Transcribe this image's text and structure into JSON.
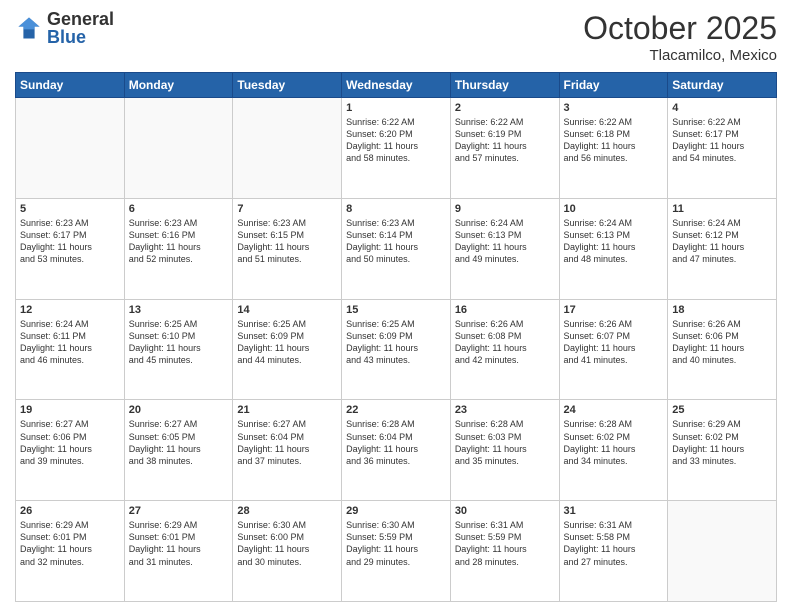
{
  "header": {
    "logo_general": "General",
    "logo_blue": "Blue",
    "month": "October 2025",
    "location": "Tlacamilco, Mexico"
  },
  "weekdays": [
    "Sunday",
    "Monday",
    "Tuesday",
    "Wednesday",
    "Thursday",
    "Friday",
    "Saturday"
  ],
  "weeks": [
    [
      {
        "day": "",
        "empty": true
      },
      {
        "day": "",
        "empty": true
      },
      {
        "day": "",
        "empty": true
      },
      {
        "day": "1",
        "sunrise": "6:22 AM",
        "sunset": "6:20 PM",
        "daylight": "11 hours and 58 minutes."
      },
      {
        "day": "2",
        "sunrise": "6:22 AM",
        "sunset": "6:19 PM",
        "daylight": "11 hours and 57 minutes."
      },
      {
        "day": "3",
        "sunrise": "6:22 AM",
        "sunset": "6:18 PM",
        "daylight": "11 hours and 56 minutes."
      },
      {
        "day": "4",
        "sunrise": "6:22 AM",
        "sunset": "6:17 PM",
        "daylight": "11 hours and 54 minutes."
      }
    ],
    [
      {
        "day": "5",
        "sunrise": "6:23 AM",
        "sunset": "6:17 PM",
        "daylight": "11 hours and 53 minutes."
      },
      {
        "day": "6",
        "sunrise": "6:23 AM",
        "sunset": "6:16 PM",
        "daylight": "11 hours and 52 minutes."
      },
      {
        "day": "7",
        "sunrise": "6:23 AM",
        "sunset": "6:15 PM",
        "daylight": "11 hours and 51 minutes."
      },
      {
        "day": "8",
        "sunrise": "6:23 AM",
        "sunset": "6:14 PM",
        "daylight": "11 hours and 50 minutes."
      },
      {
        "day": "9",
        "sunrise": "6:24 AM",
        "sunset": "6:13 PM",
        "daylight": "11 hours and 49 minutes."
      },
      {
        "day": "10",
        "sunrise": "6:24 AM",
        "sunset": "6:13 PM",
        "daylight": "11 hours and 48 minutes."
      },
      {
        "day": "11",
        "sunrise": "6:24 AM",
        "sunset": "6:12 PM",
        "daylight": "11 hours and 47 minutes."
      }
    ],
    [
      {
        "day": "12",
        "sunrise": "6:24 AM",
        "sunset": "6:11 PM",
        "daylight": "11 hours and 46 minutes."
      },
      {
        "day": "13",
        "sunrise": "6:25 AM",
        "sunset": "6:10 PM",
        "daylight": "11 hours and 45 minutes."
      },
      {
        "day": "14",
        "sunrise": "6:25 AM",
        "sunset": "6:09 PM",
        "daylight": "11 hours and 44 minutes."
      },
      {
        "day": "15",
        "sunrise": "6:25 AM",
        "sunset": "6:09 PM",
        "daylight": "11 hours and 43 minutes."
      },
      {
        "day": "16",
        "sunrise": "6:26 AM",
        "sunset": "6:08 PM",
        "daylight": "11 hours and 42 minutes."
      },
      {
        "day": "17",
        "sunrise": "6:26 AM",
        "sunset": "6:07 PM",
        "daylight": "11 hours and 41 minutes."
      },
      {
        "day": "18",
        "sunrise": "6:26 AM",
        "sunset": "6:06 PM",
        "daylight": "11 hours and 40 minutes."
      }
    ],
    [
      {
        "day": "19",
        "sunrise": "6:27 AM",
        "sunset": "6:06 PM",
        "daylight": "11 hours and 39 minutes."
      },
      {
        "day": "20",
        "sunrise": "6:27 AM",
        "sunset": "6:05 PM",
        "daylight": "11 hours and 38 minutes."
      },
      {
        "day": "21",
        "sunrise": "6:27 AM",
        "sunset": "6:04 PM",
        "daylight": "11 hours and 37 minutes."
      },
      {
        "day": "22",
        "sunrise": "6:28 AM",
        "sunset": "6:04 PM",
        "daylight": "11 hours and 36 minutes."
      },
      {
        "day": "23",
        "sunrise": "6:28 AM",
        "sunset": "6:03 PM",
        "daylight": "11 hours and 35 minutes."
      },
      {
        "day": "24",
        "sunrise": "6:28 AM",
        "sunset": "6:02 PM",
        "daylight": "11 hours and 34 minutes."
      },
      {
        "day": "25",
        "sunrise": "6:29 AM",
        "sunset": "6:02 PM",
        "daylight": "11 hours and 33 minutes."
      }
    ],
    [
      {
        "day": "26",
        "sunrise": "6:29 AM",
        "sunset": "6:01 PM",
        "daylight": "11 hours and 32 minutes."
      },
      {
        "day": "27",
        "sunrise": "6:29 AM",
        "sunset": "6:01 PM",
        "daylight": "11 hours and 31 minutes."
      },
      {
        "day": "28",
        "sunrise": "6:30 AM",
        "sunset": "6:00 PM",
        "daylight": "11 hours and 30 minutes."
      },
      {
        "day": "29",
        "sunrise": "6:30 AM",
        "sunset": "5:59 PM",
        "daylight": "11 hours and 29 minutes."
      },
      {
        "day": "30",
        "sunrise": "6:31 AM",
        "sunset": "5:59 PM",
        "daylight": "11 hours and 28 minutes."
      },
      {
        "day": "31",
        "sunrise": "6:31 AM",
        "sunset": "5:58 PM",
        "daylight": "11 hours and 27 minutes."
      },
      {
        "day": "",
        "empty": true
      }
    ]
  ],
  "labels": {
    "sunrise": "Sunrise:",
    "sunset": "Sunset:",
    "daylight": "Daylight:"
  }
}
